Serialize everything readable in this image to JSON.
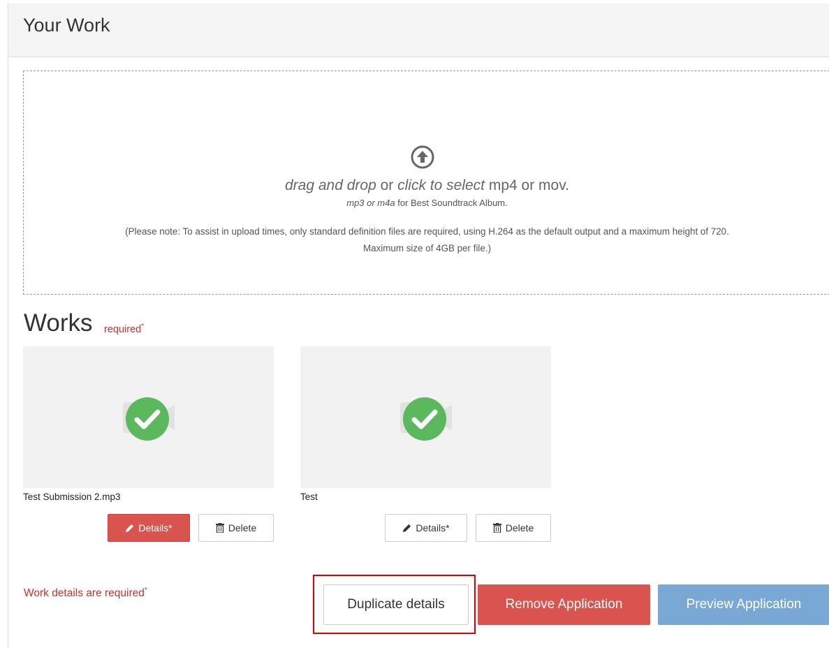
{
  "panel": {
    "title": "Your Work"
  },
  "dropzone": {
    "icon": "upload-arrow-icon",
    "main_a": "drag and drop",
    "main_b": " or ",
    "main_c": "click to select",
    "main_d": " mp4 or mov.",
    "sub_a": "mp3 or m4a",
    "sub_b": " for Best Soundtrack Album.",
    "note_line1": "(Please note: To assist in upload times, only standard definition files are required, using H.264 as the default output and a maximum height of 720.",
    "note_line2": "Maximum size of 4GB per file.)"
  },
  "works": {
    "title": "Works",
    "required_label": "required",
    "required_star": "*",
    "items": [
      {
        "name": "Test Submission 2.mp3",
        "details_label": "Details*",
        "delete_label": "Delete",
        "status_icon": "check-circle-icon",
        "details_state": "error"
      },
      {
        "name": "Test",
        "details_label": "Details*",
        "delete_label": "Delete",
        "status_icon": "check-circle-icon",
        "details_state": "default"
      }
    ]
  },
  "footer": {
    "error_message": "Work details are required",
    "error_star": "*",
    "duplicate_label": "Duplicate details",
    "remove_label": "Remove Application",
    "preview_label": "Preview Application"
  },
  "colors": {
    "danger": "#d9534f",
    "primary_light": "#7aa8d4",
    "success": "#5cb85c",
    "highlight": "#e00000"
  }
}
